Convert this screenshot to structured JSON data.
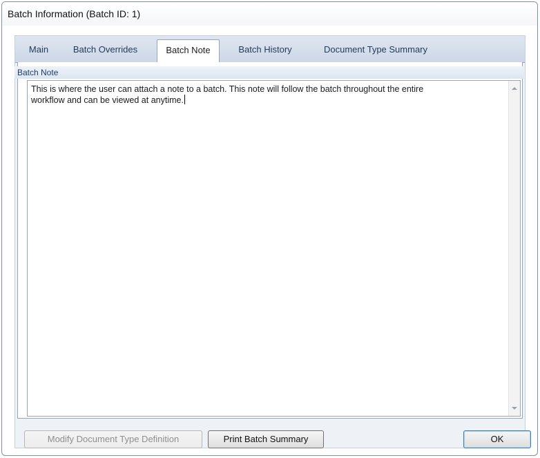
{
  "window": {
    "title": "Batch Information (Batch ID: 1)"
  },
  "tabs": [
    {
      "label": "Main",
      "active": false
    },
    {
      "label": "Batch Overrides",
      "active": false
    },
    {
      "label": "Batch Note",
      "active": true
    },
    {
      "label": "Batch History",
      "active": false
    },
    {
      "label": "Document Type Summary",
      "active": false
    }
  ],
  "batch_note": {
    "header": "Batch Note",
    "text": "This is where the user can attach a note to a batch. This note will follow the batch throughout the entire\nworkflow and can be viewed at anytime."
  },
  "buttons": {
    "modify_label": "Modify Document Type Definition",
    "modify_enabled": false,
    "print_label": "Print Batch Summary",
    "ok_label": "OK"
  },
  "icons": {
    "scroll_up": "scroll-up-arrow-icon",
    "scroll_down": "scroll-down-arrow-icon"
  }
}
